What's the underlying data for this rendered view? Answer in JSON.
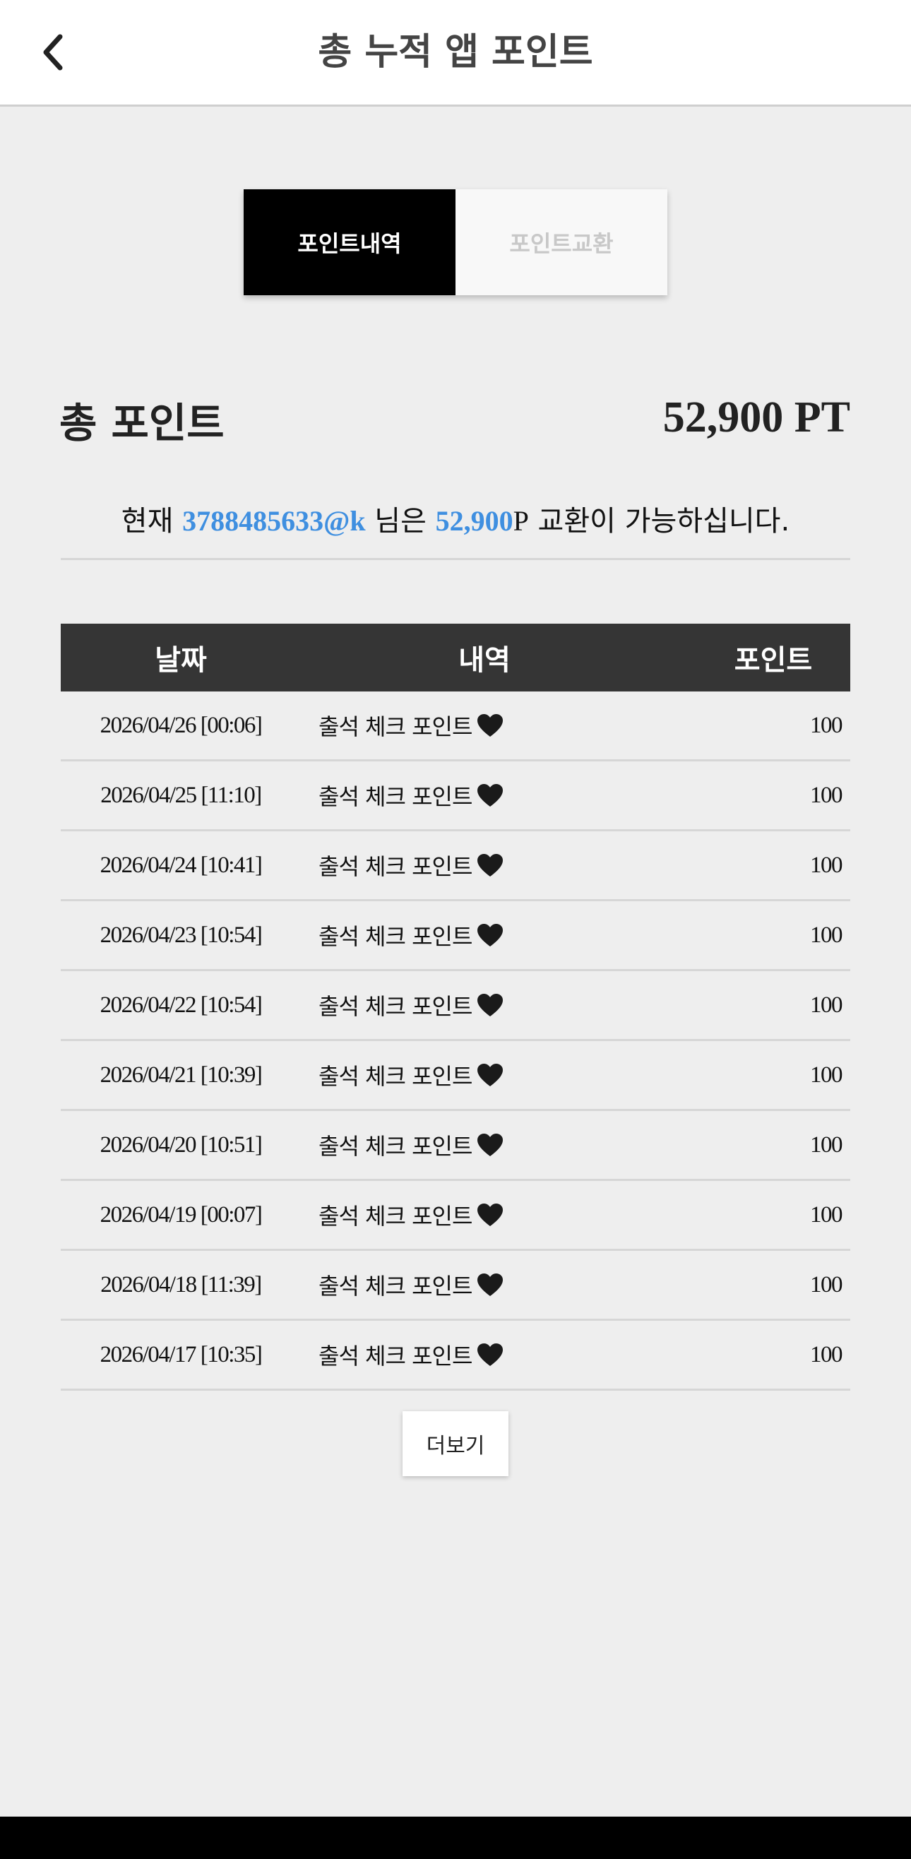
{
  "header": {
    "title": "총 누적 앱 포인트"
  },
  "tabs": [
    {
      "label": "포인트내역",
      "active": true
    },
    {
      "label": "포인트교환",
      "active": false
    }
  ],
  "summary": {
    "total_label": "총 포인트",
    "total_value": "52,900 PT"
  },
  "notice": {
    "prefix": "현재 ",
    "user_id": "3788485633@k",
    "middle": " 님은 ",
    "points": "52,900",
    "suffix_p": "P",
    "suffix": " 교환이 가능하십니다."
  },
  "table": {
    "headers": {
      "date": "날짜",
      "desc": "내역",
      "points": "포인트"
    },
    "rows": [
      {
        "date": "2026/04/26 [00:06]",
        "desc": "출석 체크 포인트",
        "points": "100"
      },
      {
        "date": "2026/04/25 [11:10]",
        "desc": "출석 체크 포인트",
        "points": "100"
      },
      {
        "date": "2026/04/24 [10:41]",
        "desc": "출석 체크 포인트",
        "points": "100"
      },
      {
        "date": "2026/04/23 [10:54]",
        "desc": "출석 체크 포인트",
        "points": "100"
      },
      {
        "date": "2026/04/22 [10:54]",
        "desc": "출석 체크 포인트",
        "points": "100"
      },
      {
        "date": "2026/04/21 [10:39]",
        "desc": "출석 체크 포인트",
        "points": "100"
      },
      {
        "date": "2026/04/20 [10:51]",
        "desc": "출석 체크 포인트",
        "points": "100"
      },
      {
        "date": "2026/04/19 [00:07]",
        "desc": "출석 체크 포인트",
        "points": "100"
      },
      {
        "date": "2026/04/18 [11:39]",
        "desc": "출석 체크 포인트",
        "points": "100"
      },
      {
        "date": "2026/04/17 [10:35]",
        "desc": "출석 체크 포인트",
        "points": "100"
      }
    ]
  },
  "more_button": {
    "label": "더보기"
  },
  "icons": {
    "back": "chevron-left-icon",
    "row_icon": "black-heart-icon"
  },
  "colors": {
    "accent": "#3f8fe0",
    "table_header": "#353535",
    "tab_active": "#000000"
  }
}
